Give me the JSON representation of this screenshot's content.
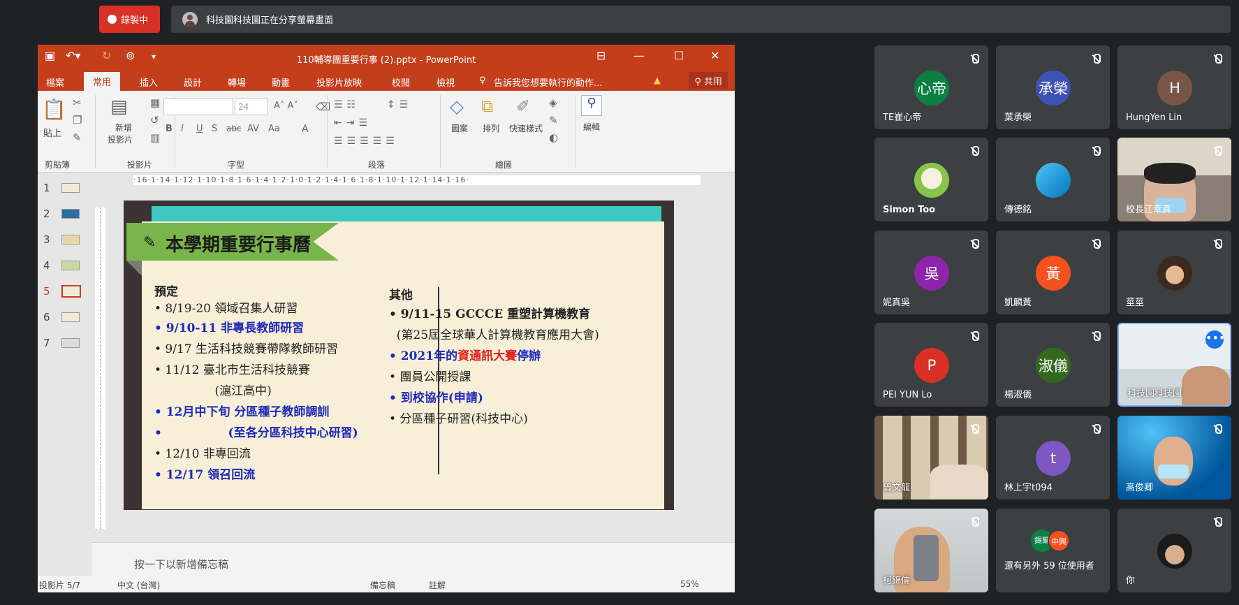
{
  "recording": {
    "label": "錄製中"
  },
  "presenter_bar": {
    "text": "科技園科技園正在分享螢幕畫面"
  },
  "ppt": {
    "title": "110輔導團重要行事 (2).pptx - PowerPoint",
    "tabs": [
      "檔案",
      "常用",
      "插入",
      "設計",
      "轉場",
      "動畫",
      "投影片放映",
      "校閱",
      "檢視"
    ],
    "tell_me": "告訴我您想要執行的動作...",
    "share": "共用",
    "ribbon": {
      "paste": "貼上",
      "clipboard": "剪貼簿",
      "new_slide_1": "新增",
      "new_slide_2": "投影片",
      "slides": "投影片",
      "font_size": "24",
      "font_group": "字型",
      "paragraph": "段落",
      "shapes": "圖案",
      "arrange": "排列",
      "quick_styles": "快速樣式",
      "drawing": "繪圖",
      "editing": "編輯"
    },
    "ruler": "·16·1·14·1·12·1·10·1·8·1·6·1·4·1·2·1·0·1·2·1·4·1·6·1·8·1·10·1·12·1·14·1·16·",
    "slide_numbers": [
      "1",
      "2",
      "3",
      "4",
      "5",
      "6",
      "7"
    ],
    "notes_placeholder": "按一下以新增備忘稿",
    "status": {
      "slide": "投影片 5/7",
      "lang": "中文 (台灣)",
      "notes": "備忘稿",
      "comments": "註解",
      "zoom": "55%"
    }
  },
  "slide": {
    "title": "本學期重要行事曆",
    "left": {
      "heading": "預定",
      "items": [
        {
          "text": "• 8/19-20 領域召集人研習",
          "style": "normal"
        },
        {
          "text": "• 9/10-11  非專長教師研習",
          "style": "blue"
        },
        {
          "text": "• 9/17      生活科技競賽帶隊教師研習",
          "style": "normal"
        },
        {
          "text": "• 11/12     臺北市生活科技競賽",
          "style": "normal"
        },
        {
          "text": "                (滬江高中)",
          "style": "normal"
        },
        {
          "text": "• 12月中下旬  分區種子教師調訓",
          "style": "blue"
        },
        {
          "text": "•                (至各分區科技中心研習)",
          "style": "blue"
        },
        {
          "text": "• 12/10     非專回流",
          "style": "normal"
        },
        {
          "text": "• 12/17     領召回流",
          "style": "blue"
        }
      ]
    },
    "right": {
      "heading": "其他",
      "item1": "• 9/11-15  GCCCE  重塑計算機教育",
      "item1_sub": "  (第25屆全球華人計算機教育應用大會)",
      "item2_a": "• 2021年的",
      "item2_b": "資通訊大賽",
      "item2_c": "停辦",
      "item3": "• 團員公開授課",
      "item4": "• 到校協作(申請)",
      "item5": "• 分區種子研習(科技中心)"
    }
  },
  "participants": [
    {
      "name": "TE崔心帝",
      "initials": "心帝",
      "color": "#0b8043"
    },
    {
      "name": "葉承榮",
      "initials": "承榮",
      "color": "#3f51b5"
    },
    {
      "name": "HungYen Lin",
      "initials": "H",
      "color": "#795548"
    },
    {
      "name": "Simon Too",
      "initials": "",
      "color": "#8bc34a"
    },
    {
      "name": "傳德銘",
      "initials": "",
      "color": "#29b6f6"
    },
    {
      "name": "校長江幸真",
      "initials": "",
      "color": ""
    },
    {
      "name": "妮真吳",
      "initials": "吳",
      "color": "#8e24aa"
    },
    {
      "name": "凱麟黃",
      "initials": "黃",
      "color": "#f4511e"
    },
    {
      "name": "莖莖",
      "initials": "",
      "color": "#d4a373"
    },
    {
      "name": "PEI YUN Lo",
      "initials": "P",
      "color": "#d93025"
    },
    {
      "name": "楊淑儀",
      "initials": "淑儀",
      "color": "#33691e"
    },
    {
      "name": "科技園科技園",
      "initials": "",
      "color": ""
    },
    {
      "name": "曾文龍",
      "initials": "",
      "color": ""
    },
    {
      "name": "林上宇t094",
      "initials": "t",
      "color": "#7e57c2"
    },
    {
      "name": "高俊卿",
      "initials": "",
      "color": ""
    },
    {
      "name": "柯錦儒",
      "initials": "",
      "color": ""
    },
    {
      "name": "還有另外 59 位使用者",
      "initials": "",
      "color": ""
    },
    {
      "name": "你",
      "initials": "",
      "color": ""
    }
  ],
  "others_badges": {
    "a": "錫爾",
    "b": "中興"
  }
}
